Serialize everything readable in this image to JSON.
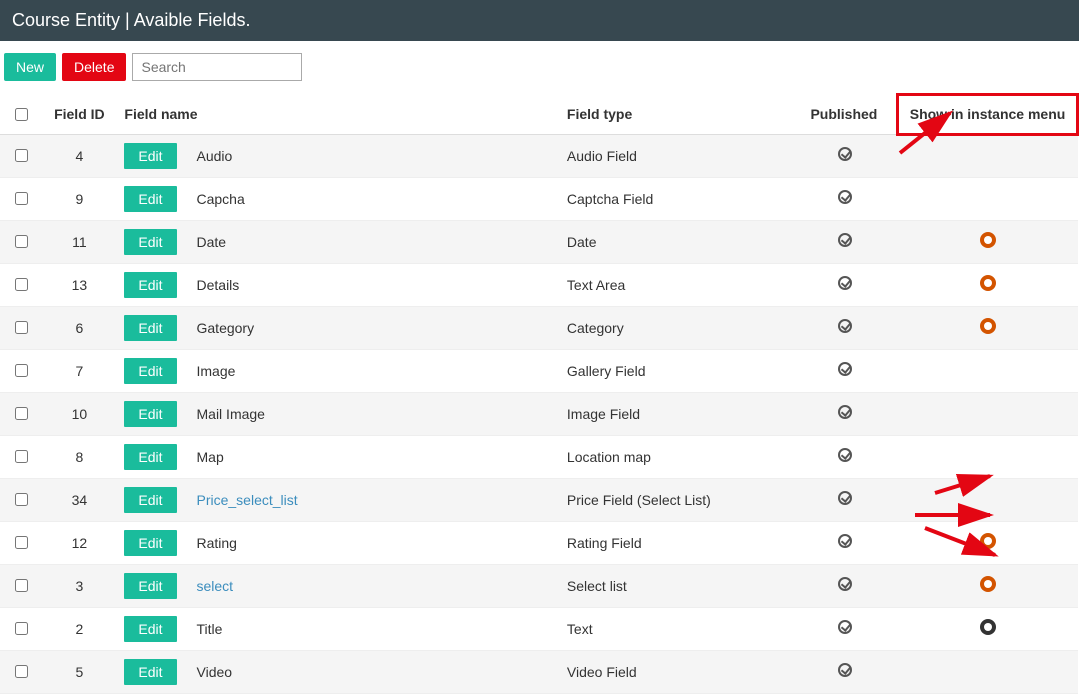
{
  "header": {
    "title": "Course Entity | Avaible Fields."
  },
  "toolbar": {
    "new_label": "New",
    "delete_label": "Delete",
    "search_placeholder": "Search"
  },
  "columns": {
    "id": "Field ID",
    "name": "Field name",
    "type": "Field type",
    "published": "Published",
    "show": "Show in instance menu"
  },
  "edit_label": "Edit",
  "rows": [
    {
      "id": "4",
      "name": "Audio",
      "type": "Audio Field",
      "published": true,
      "link": false,
      "show": ""
    },
    {
      "id": "9",
      "name": "Capcha",
      "type": "Captcha Field",
      "published": true,
      "link": false,
      "show": ""
    },
    {
      "id": "11",
      "name": "Date",
      "type": "Date",
      "published": true,
      "link": false,
      "show": "orange"
    },
    {
      "id": "13",
      "name": "Details",
      "type": "Text Area",
      "published": true,
      "link": false,
      "show": "orange"
    },
    {
      "id": "6",
      "name": "Gategory",
      "type": "Category",
      "published": true,
      "link": false,
      "show": "orange"
    },
    {
      "id": "7",
      "name": "Image",
      "type": "Gallery Field",
      "published": true,
      "link": false,
      "show": ""
    },
    {
      "id": "10",
      "name": "Mail Image",
      "type": "Image Field",
      "published": true,
      "link": false,
      "show": ""
    },
    {
      "id": "8",
      "name": "Map",
      "type": "Location map",
      "published": true,
      "link": false,
      "show": ""
    },
    {
      "id": "34",
      "name": "Price_select_list",
      "type": "Price Field (Select List)",
      "published": true,
      "link": true,
      "show": ""
    },
    {
      "id": "12",
      "name": "Rating",
      "type": "Rating Field",
      "published": true,
      "link": false,
      "show": "orange"
    },
    {
      "id": "3",
      "name": "select",
      "type": "Select list",
      "published": true,
      "link": true,
      "show": "orange"
    },
    {
      "id": "2",
      "name": "Title",
      "type": "Text",
      "published": true,
      "link": false,
      "show": "dark"
    },
    {
      "id": "5",
      "name": "Video",
      "type": "Video Field",
      "published": true,
      "link": false,
      "show": ""
    }
  ],
  "annotations": {
    "highlight_column": "show",
    "arrows": [
      {
        "target": "header-show"
      },
      {
        "target": "row-rating-show"
      },
      {
        "target": "row-select-show"
      },
      {
        "target": "row-title-show"
      }
    ]
  }
}
